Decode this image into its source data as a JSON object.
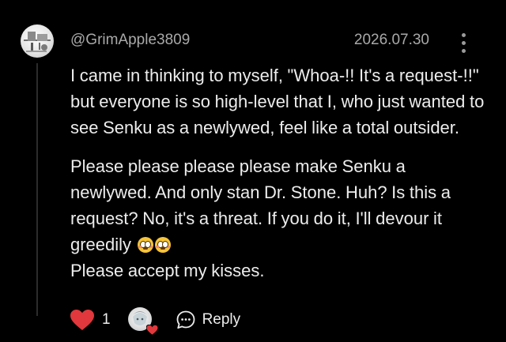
{
  "comment": {
    "username": "@GrimApple3809",
    "date": "2026.07.30",
    "paragraphs": [
      "I came in thinking to myself, \"Whoa-!! It's a request-!!\" but everyone is so high-level that I, who just wanted to see Senku as a newlywed, feel like a total outsider.",
      "Please please please please make Senku a newlywed. And only stan Dr. Stone. Huh? Is this a request? No, it's a threat. If you do it, I'll devour it greedily"
    ],
    "paragraph2_tail": "Please accept my kisses.",
    "emoji_icons": [
      "flushed-face-icon",
      "flushed-face-icon"
    ]
  },
  "actions": {
    "like_count": "1",
    "reply_label": "Reply"
  },
  "colors": {
    "background": "#000000",
    "text": "#ededed",
    "meta_text": "#a9a9a9",
    "heart": "#e0383c"
  }
}
